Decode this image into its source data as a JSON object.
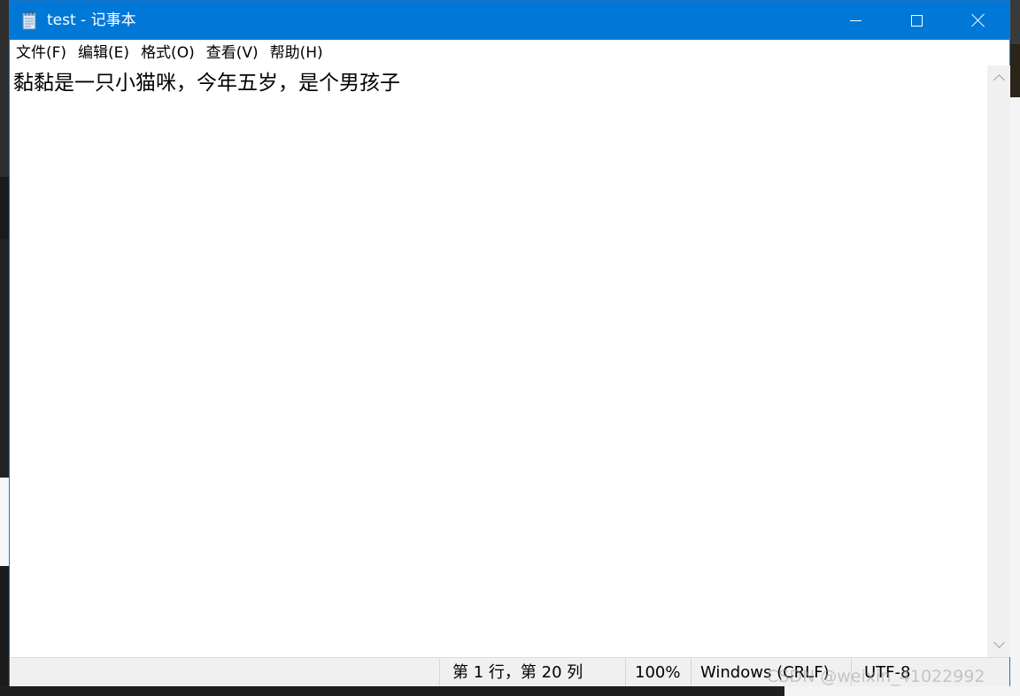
{
  "window": {
    "title": "test - 记事本",
    "icon": "notepad-icon",
    "controls": {
      "minimize": "minimize-icon",
      "maximize": "maximize-icon",
      "close": "close-icon"
    }
  },
  "menu": {
    "items": [
      {
        "label": "文件(F)"
      },
      {
        "label": "编辑(E)"
      },
      {
        "label": "格式(O)"
      },
      {
        "label": "查看(V)"
      },
      {
        "label": "帮助(H)"
      }
    ]
  },
  "editor": {
    "content": "黏黏是一只小猫咪，今年五岁，是个男孩子"
  },
  "statusbar": {
    "position": "第 1 行，第 20 列",
    "zoom": "100%",
    "line_ending": "Windows (CRLF)",
    "encoding": "UTF-8"
  },
  "overlay": {
    "watermark": "CSDN @weixin_41022992"
  },
  "colors": {
    "titlebar": "#0078d7",
    "statusbar": "#f0f0f0",
    "scrollbar": "#f0f0f0"
  }
}
